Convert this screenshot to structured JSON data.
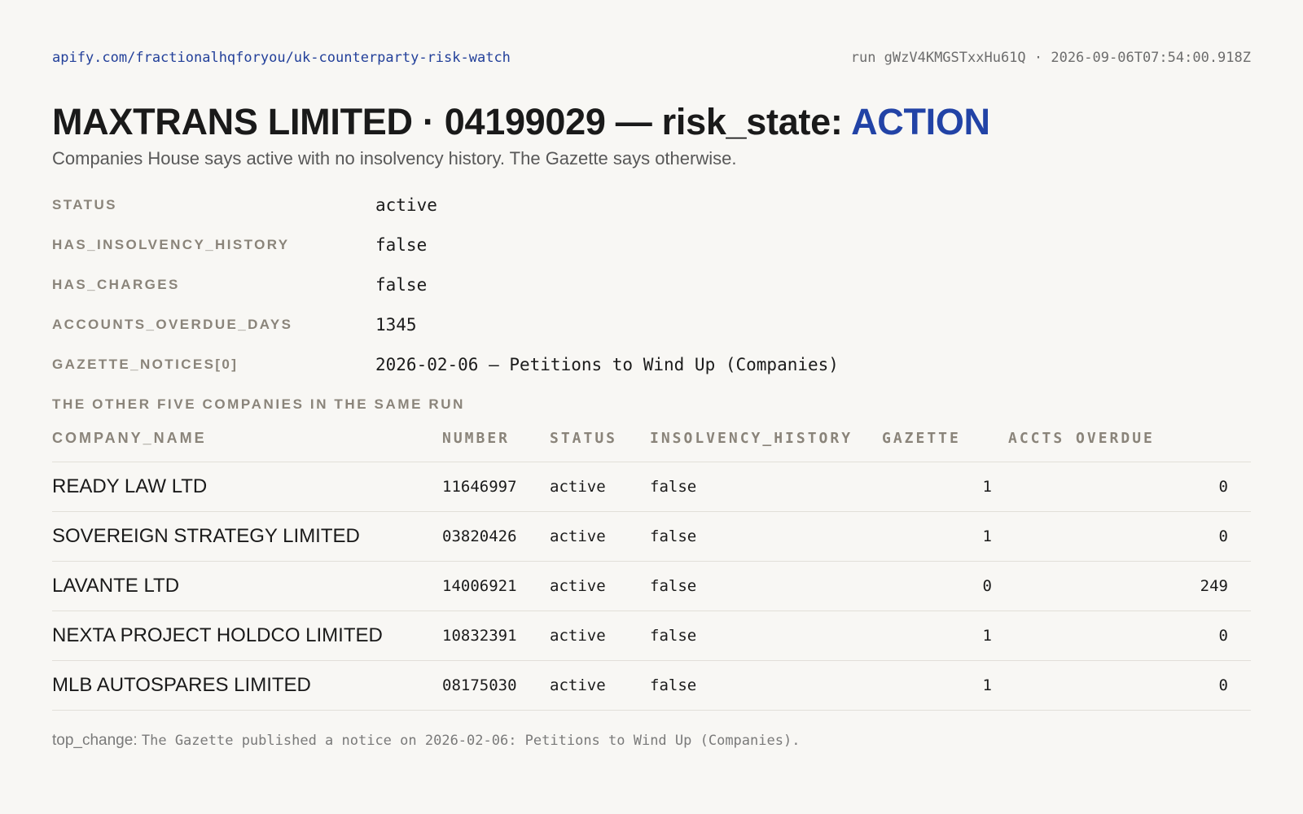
{
  "header": {
    "url": "apify.com/fractionalhqforyou/uk-counterparty-risk-watch",
    "run_info": "run gWzV4KMGSTxxHu61Q · 2026-09-06T07:54:00.918Z"
  },
  "title": {
    "company": "MAXTRANS LIMITED · 04199029 — risk_state: ",
    "risk_state": "ACTION"
  },
  "subtitle": "Companies House says active with no insolvency history. The Gazette says otherwise.",
  "fields": [
    {
      "key": "STATUS",
      "value": "active"
    },
    {
      "key": "HAS_INSOLVENCY_HISTORY",
      "value": "false"
    },
    {
      "key": "HAS_CHARGES",
      "value": "false"
    },
    {
      "key": "ACCOUNTS_OVERDUE_DAYS",
      "value": "1345"
    },
    {
      "key": "GAZETTE_NOTICES[0]",
      "value": "2026-02-06 — Petitions to Wind Up (Companies)"
    }
  ],
  "others_label": "THE OTHER FIVE COMPANIES IN THE SAME RUN",
  "table": {
    "headers": [
      "COMPANY_NAME",
      "NUMBER",
      "STATUS",
      "INSOLVENCY_HISTORY",
      "GAZETTE",
      "ACCTS OVERDUE"
    ],
    "rows": [
      [
        "READY LAW LTD",
        "11646997",
        "active",
        "false",
        "1",
        "0"
      ],
      [
        "SOVEREIGN STRATEGY LIMITED",
        "03820426",
        "active",
        "false",
        "1",
        "0"
      ],
      [
        "LAVANTE LTD",
        "14006921",
        "active",
        "false",
        "0",
        "249"
      ],
      [
        "NEXTA PROJECT HOLDCO LIMITED",
        "10832391",
        "active",
        "false",
        "1",
        "0"
      ],
      [
        "MLB AUTOSPARES LIMITED",
        "08175030",
        "active",
        "false",
        "1",
        "0"
      ]
    ]
  },
  "footer": {
    "key": "top_change:",
    "value": "The Gazette published a notice on 2026-02-06: Petitions to Wind Up (Companies)."
  },
  "colors": {
    "accent": "#2243a6",
    "link": "#23409a",
    "label": "#8a847a",
    "background": "#f8f7f4"
  }
}
